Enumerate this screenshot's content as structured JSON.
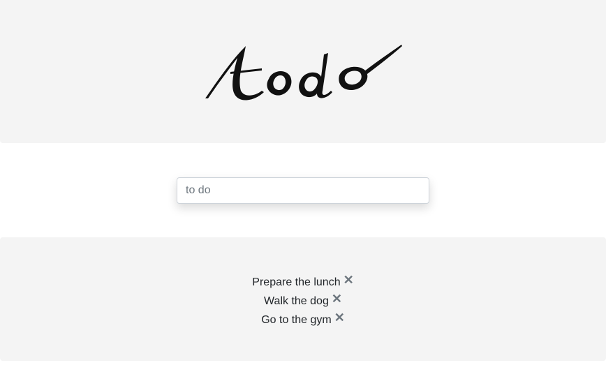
{
  "header": {
    "logo_text": "todo"
  },
  "input": {
    "placeholder": "to do",
    "value": ""
  },
  "todos": [
    {
      "label": "Prepare the lunch",
      "delete_icon": "✕"
    },
    {
      "label": "Walk the dog",
      "delete_icon": "✕"
    },
    {
      "label": "Go to the gym",
      "delete_icon": "✕"
    }
  ],
  "colors": {
    "panel_bg": "#f4f4f4",
    "text": "#212529",
    "icon": "#6c757d"
  },
  "icons": {
    "delete": "close-icon"
  }
}
